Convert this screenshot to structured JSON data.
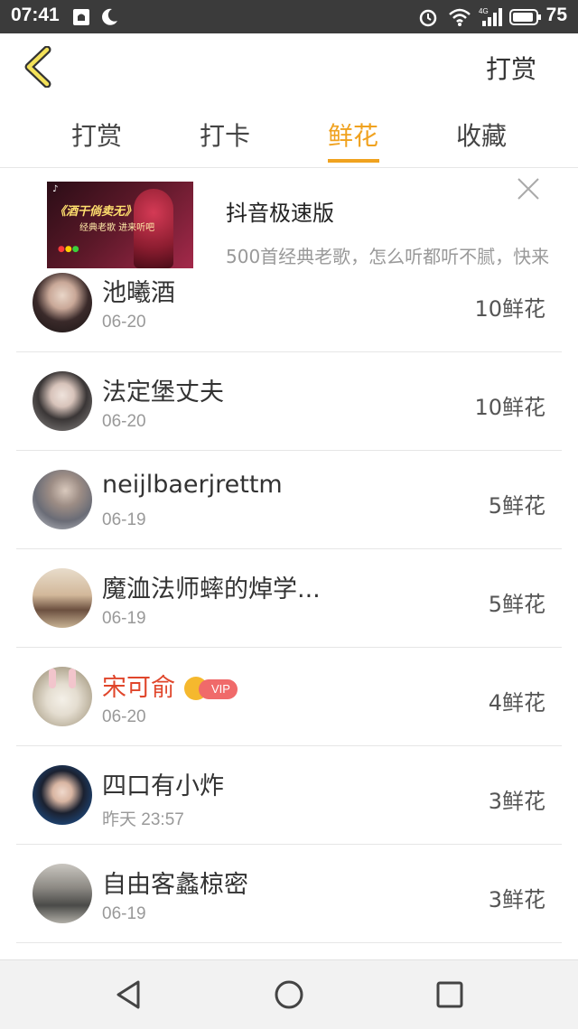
{
  "status_bar": {
    "time": "07:41",
    "battery": "75",
    "icons": [
      "notification-icon",
      "moon-icon",
      "alarm-icon",
      "wifi-icon",
      "signal-4g-icon",
      "battery-icon"
    ]
  },
  "header": {
    "back_icon": "chevron-left-icon",
    "action_label": "打赏"
  },
  "tabs": [
    {
      "label": "打赏",
      "active": false
    },
    {
      "label": "打卡",
      "active": false
    },
    {
      "label": "鲜花",
      "active": true
    },
    {
      "label": "收藏",
      "active": false
    }
  ],
  "accent_color": "#f0a21f",
  "ad": {
    "title": "抖音极速版",
    "description": "500首经典老歌，怎么听都听不腻，快来",
    "image_title": "《酒干倘卖无》",
    "image_subtitle": "经典老歌 进来听吧",
    "close_icon": "close-icon"
  },
  "list": [
    {
      "name": "池曦酒",
      "date": "06-20",
      "amount": "10鲜花",
      "vip": false
    },
    {
      "name": "法定堡丈夫",
      "date": "06-20",
      "amount": "10鲜花",
      "vip": false
    },
    {
      "name": "neijlbaerjrettm",
      "date": "06-19",
      "amount": "5鲜花",
      "vip": false
    },
    {
      "name": "魔洫法师蟀的焯学...",
      "date": "06-19",
      "amount": "5鲜花",
      "vip": false
    },
    {
      "name": "宋可俞",
      "date": "06-20",
      "amount": "4鲜花",
      "vip": true,
      "vip_label": "VIP"
    },
    {
      "name": "四口有小炸",
      "date": "昨天 23:57",
      "amount": "3鲜花",
      "vip": false
    },
    {
      "name": "自由客蠡椋密",
      "date": "06-19",
      "amount": "3鲜花",
      "vip": false
    }
  ],
  "navbar": {
    "icons": [
      "back-triangle-icon",
      "home-circle-icon",
      "recents-square-icon"
    ]
  }
}
